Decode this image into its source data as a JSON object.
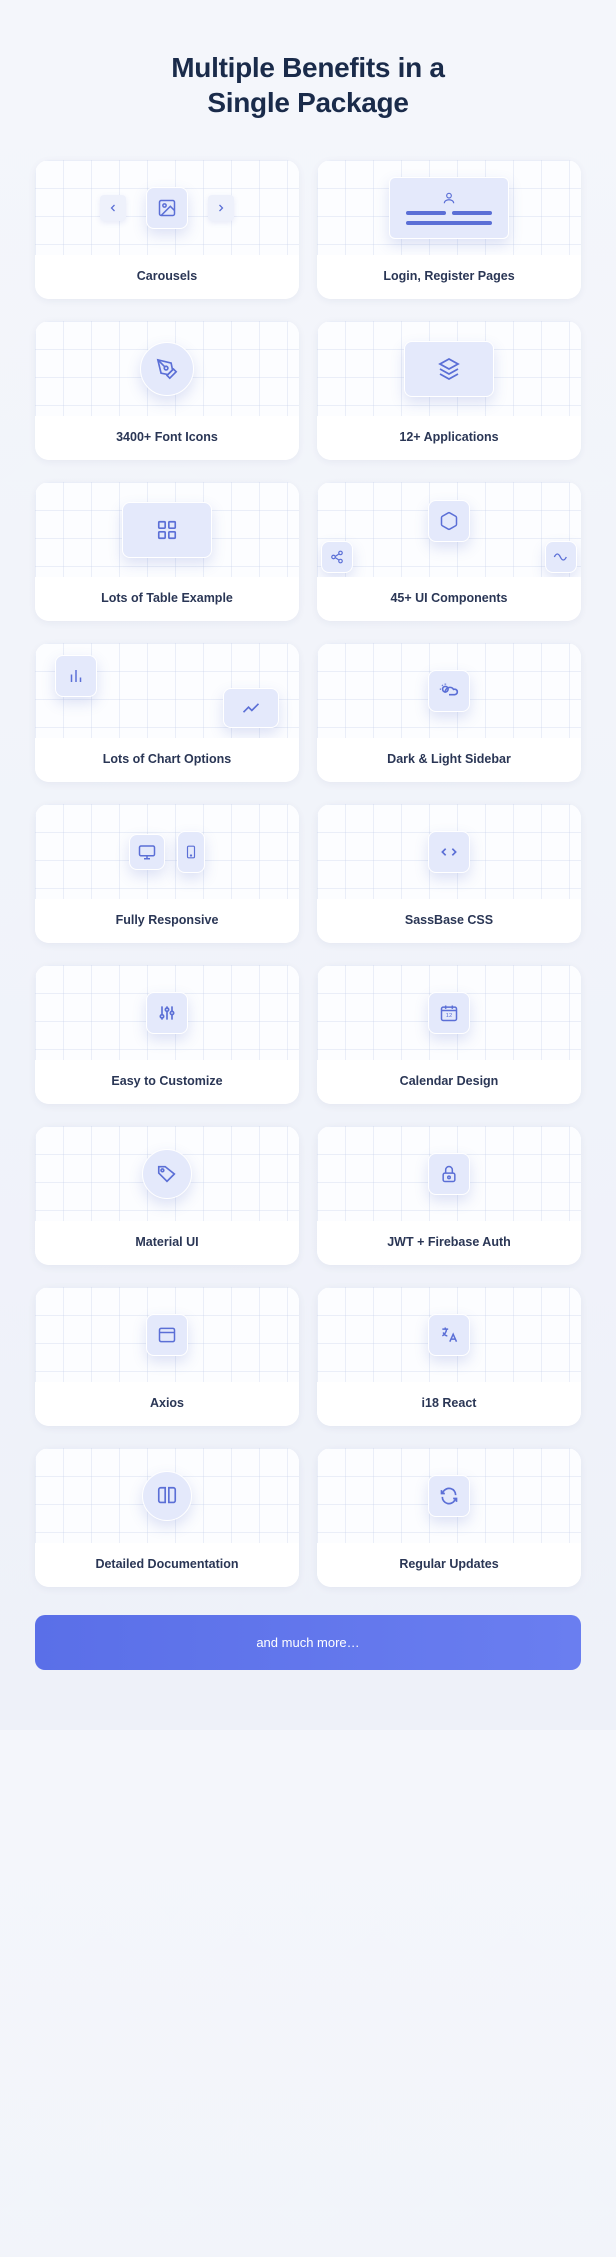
{
  "heading": "Multiple Benefits in a\nSingle Package",
  "cards": [
    {
      "label": "Carousels"
    },
    {
      "label": "Login, Register Pages"
    },
    {
      "label": "3400+ Font Icons"
    },
    {
      "label": "12+ Applications"
    },
    {
      "label": "Lots of Table Example"
    },
    {
      "label": "45+ UI Components"
    },
    {
      "label": "Lots of Chart Options"
    },
    {
      "label": "Dark & Light Sidebar"
    },
    {
      "label": "Fully Responsive"
    },
    {
      "label": "SassBase CSS"
    },
    {
      "label": "Easy to Customize"
    },
    {
      "label": "Calendar Design"
    },
    {
      "label": "Material UI"
    },
    {
      "label": "JWT + Firebase Auth"
    },
    {
      "label": "Axios"
    },
    {
      "label": "i18 React"
    },
    {
      "label": "Detailed Documentation"
    },
    {
      "label": "Regular Updates"
    }
  ],
  "cta": "and much more…"
}
